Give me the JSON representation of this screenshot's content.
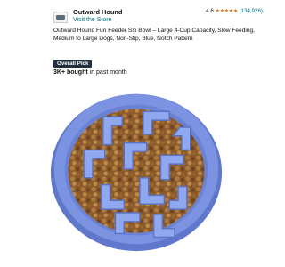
{
  "store": {
    "brand": "Outward Hound",
    "visit_link": "Visit the Store",
    "rating_value": "4.6",
    "stars": "★★★★★",
    "rating_count": "(134,926)"
  },
  "product": {
    "title": "Outward Hound Fun Feeder Slo Bowl – Large 4-Cup Capacity, Slow Feeding, Medium to Large Dogs, Non-Slip, Blue, Notch Pattern",
    "badge": "Overall Pick",
    "bought_bold": "3K+ bought",
    "bought_rest": " in past month",
    "image_name": "blue slow feeder dog bowl with kibble"
  },
  "colors": {
    "link": "#007185",
    "star": "#de7921",
    "badge_bg": "#232f3e",
    "bowl_blue": "#6f86d8"
  }
}
